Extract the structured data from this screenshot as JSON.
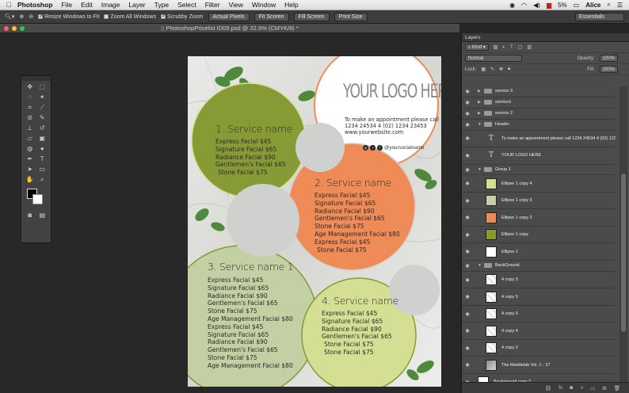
{
  "menubar": {
    "app": "Photoshop",
    "items": [
      "File",
      "Edit",
      "Image",
      "Layer",
      "Type",
      "Select",
      "Filter",
      "View",
      "Window",
      "Help"
    ],
    "battery": "5%",
    "user": "Alice"
  },
  "options": {
    "resize_windows": "Resize Windows to Fit",
    "zoom_all": "Zoom All Windows",
    "scrubby": "Scrubby Zoom",
    "actual_pixels": "Actual Pixels",
    "fit_screen": "Fit Screen",
    "fill_screen": "Fill Screen",
    "print_size": "Print Size",
    "workspace": "Essentials"
  },
  "document": {
    "tab_title": "PhotoshopPricelist ID09.psd @ 22.9% (CMYK/8) *",
    "logo": "YOUR LOGO HERE",
    "contact_line1": "To make an appointment please call",
    "contact_line2": "1234 24534 4 (02) 1234 23453",
    "contact_line3": "www.yourwebsite.com",
    "social": "@yoursocialname",
    "services": [
      {
        "title": "1. Service name",
        "items": [
          "Express Facial $45",
          "Signature Facial $65",
          "Radiance Facial $90",
          "Gentlemen's Facial $65",
          "Stone Facial $75"
        ]
      },
      {
        "title": "2. Service name",
        "items": [
          "Express Facial $45",
          "Signature Facial $65",
          "Radiance Facial $90",
          "Gentlemen's Facial $65",
          "Stone Facial $75",
          "Age Management Facial $80",
          "Express Facial $45",
          "Stone Facial $75"
        ]
      },
      {
        "title": "3. Service name 1",
        "items": [
          "Express Facial $45",
          "Signature Facial $65",
          "Radiance Facial $90",
          "Gentlemen's Facial $65",
          "Stone Facial $75",
          "Age Management Facial $80",
          "Express Facial $45",
          "Signature Facial $65",
          "Radiance Facial $90",
          "Gentlemen's Facial $65",
          "Stone Facial $75",
          "Age Management Facial $80"
        ]
      },
      {
        "title": "4. Service name",
        "items": [
          "Express Facial $45",
          "Signature Facial $65",
          "Radiance Facial $90",
          "Gentlemen's Facial $65",
          "Stone Facial $75",
          "Stone Facial $75"
        ]
      }
    ],
    "colors": {
      "olive": "#869a35",
      "orange": "#ee8b57",
      "sage": "#c2d0a4",
      "lime": "#d4df93",
      "grey": "#d0d0ce"
    }
  },
  "layers_panel": {
    "title": "Layers",
    "filter": "Kind",
    "blend_mode": "Normal",
    "opacity_label": "Opacity:",
    "opacity": "100%",
    "lock_label": "Lock:",
    "fill_label": "Fill:",
    "fill": "100%",
    "layers": [
      {
        "name": "service 3",
        "kind": "folder",
        "indent": 1,
        "big": false,
        "arrow": "▶"
      },
      {
        "name": "service1",
        "kind": "folder",
        "indent": 1,
        "big": false,
        "arrow": "▶"
      },
      {
        "name": "service 2",
        "kind": "folder",
        "indent": 1,
        "big": false,
        "arrow": "▶"
      },
      {
        "name": "Header",
        "kind": "folder",
        "indent": 1,
        "big": false,
        "arrow": "▼"
      },
      {
        "name": "To make an appointment please call  1234 24534 4 (02) 1234 23453 ...",
        "kind": "text",
        "indent": 2,
        "big": true
      },
      {
        "name": "YOUR LOGO HERE",
        "kind": "text",
        "indent": 2,
        "big": true
      },
      {
        "name": "Group 1",
        "kind": "folder",
        "indent": 1,
        "big": false,
        "arrow": "▼"
      },
      {
        "name": "Ellipse 1 copy 4",
        "kind": "shape",
        "indent": 2,
        "big": true,
        "color": "#d4df93"
      },
      {
        "name": "Ellipse 1 copy 3",
        "kind": "shape",
        "indent": 2,
        "big": true,
        "color": "#c2d0a4"
      },
      {
        "name": "Ellipse 1 copy 2",
        "kind": "shape",
        "indent": 2,
        "big": true,
        "color": "#ee8b57"
      },
      {
        "name": "Ellipse 1 copy",
        "kind": "shape",
        "indent": 2,
        "big": true,
        "color": "#869a35"
      },
      {
        "name": "Ellipse 1",
        "kind": "shape",
        "indent": 2,
        "big": true,
        "color": "#ffffff"
      },
      {
        "name": "BackGround",
        "kind": "folder",
        "indent": 1,
        "big": false,
        "arrow": "▼"
      },
      {
        "name": "4 copy 3",
        "kind": "leaf",
        "indent": 2,
        "big": true
      },
      {
        "name": "4 copy 5",
        "kind": "leaf",
        "indent": 2,
        "big": true
      },
      {
        "name": "4 copy 6",
        "kind": "leaf",
        "indent": 2,
        "big": true
      },
      {
        "name": "4 copy 4",
        "kind": "leaf",
        "indent": 2,
        "big": true
      },
      {
        "name": "4 copy 2",
        "kind": "leaf",
        "indent": 2,
        "big": true
      },
      {
        "name": "The Marblelab Vol. 1 - 27",
        "kind": "marble",
        "indent": 2,
        "big": true
      },
      {
        "name": "Background copy 2",
        "kind": "white",
        "indent": 1,
        "big": true
      }
    ]
  }
}
